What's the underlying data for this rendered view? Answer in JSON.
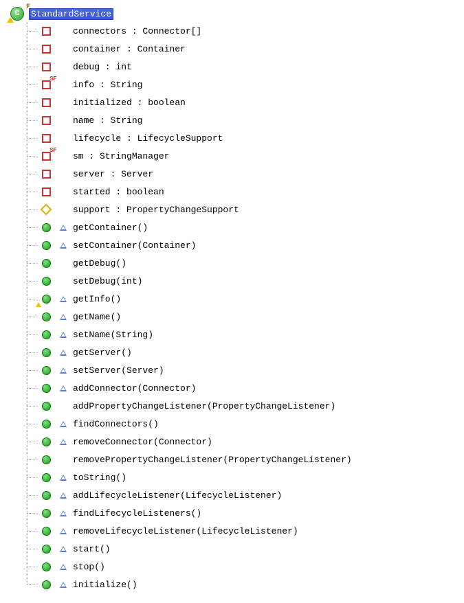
{
  "class": {
    "name": "StandardService",
    "glyph": "C",
    "final_marker": "F"
  },
  "members": [
    {
      "kind": "private-field",
      "label": "connectors : Connector[]"
    },
    {
      "kind": "private-field",
      "label": "container : Container"
    },
    {
      "kind": "private-field",
      "label": "debug : int"
    },
    {
      "kind": "private-static-final-field",
      "label": "info : String"
    },
    {
      "kind": "private-field",
      "label": "initialized : boolean"
    },
    {
      "kind": "private-field",
      "label": "name : String"
    },
    {
      "kind": "private-field",
      "label": "lifecycle : LifecycleSupport"
    },
    {
      "kind": "private-static-final-field",
      "label": "sm : StringManager"
    },
    {
      "kind": "private-field",
      "label": "server : Server"
    },
    {
      "kind": "private-field",
      "label": "started : boolean"
    },
    {
      "kind": "default-field",
      "label": "support : PropertyChangeSupport"
    },
    {
      "kind": "public-method-override",
      "label": "getContainer()"
    },
    {
      "kind": "public-method-override",
      "label": "setContainer(Container)"
    },
    {
      "kind": "public-method",
      "label": "getDebug()"
    },
    {
      "kind": "public-method",
      "label": "setDebug(int)"
    },
    {
      "kind": "public-method-override-warn",
      "label": "getInfo()"
    },
    {
      "kind": "public-method-override",
      "label": "getName()"
    },
    {
      "kind": "public-method-override",
      "label": "setName(String)"
    },
    {
      "kind": "public-method-override",
      "label": "getServer()"
    },
    {
      "kind": "public-method-override",
      "label": "setServer(Server)"
    },
    {
      "kind": "public-method-override",
      "label": "addConnector(Connector)"
    },
    {
      "kind": "public-method",
      "label": "addPropertyChangeListener(PropertyChangeListener)"
    },
    {
      "kind": "public-method-override",
      "label": "findConnectors()"
    },
    {
      "kind": "public-method-override",
      "label": "removeConnector(Connector)"
    },
    {
      "kind": "public-method",
      "label": "removePropertyChangeListener(PropertyChangeListener)"
    },
    {
      "kind": "public-method-override",
      "label": "toString()"
    },
    {
      "kind": "public-method-override",
      "label": "addLifecycleListener(LifecycleListener)"
    },
    {
      "kind": "public-method-override",
      "label": "findLifecycleListeners()"
    },
    {
      "kind": "public-method-override",
      "label": "removeLifecycleListener(LifecycleListener)"
    },
    {
      "kind": "public-method-override",
      "label": "start()"
    },
    {
      "kind": "public-method-override",
      "label": "stop()"
    },
    {
      "kind": "public-method-override",
      "label": "initialize()"
    }
  ]
}
